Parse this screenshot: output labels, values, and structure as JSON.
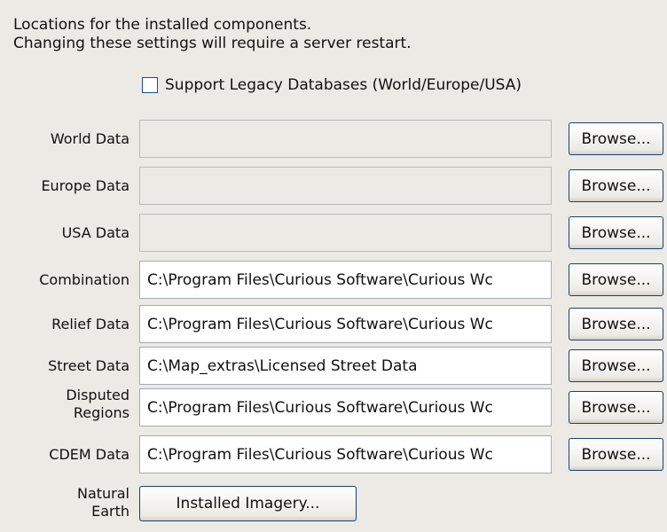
{
  "intro": {
    "line1": "Locations for the installed components.",
    "line2": "Changing these settings will require a server restart."
  },
  "legacy_checkbox": {
    "label": "Support Legacy Databases (World/Europe/USA)",
    "checked": false
  },
  "browse_label": "Browse...",
  "rows": [
    {
      "label": "World Data",
      "value": "",
      "enabled": false
    },
    {
      "label": "Europe Data",
      "value": "",
      "enabled": false
    },
    {
      "label": "USA Data",
      "value": "",
      "enabled": false
    },
    {
      "label": "Combination",
      "value": "C:\\Program Files\\Curious Software\\Curious Wc",
      "enabled": true
    },
    {
      "label": "Relief Data",
      "value": "C:\\Program Files\\Curious Software\\Curious Wc",
      "enabled": true
    },
    {
      "label": "Street Data",
      "value": "C:\\Map_extras\\Licensed Street Data",
      "enabled": true
    },
    {
      "label_line1": "Disputed",
      "label_line2": "Regions",
      "value": "C:\\Program Files\\Curious Software\\Curious Wc",
      "enabled": true
    },
    {
      "label": "CDEM Data",
      "value": "C:\\Program Files\\Curious Software\\Curious Wc",
      "enabled": true
    }
  ],
  "natural_earth": {
    "label_line1": "Natural",
    "label_line2": "Earth",
    "button": "Installed Imagery..."
  }
}
